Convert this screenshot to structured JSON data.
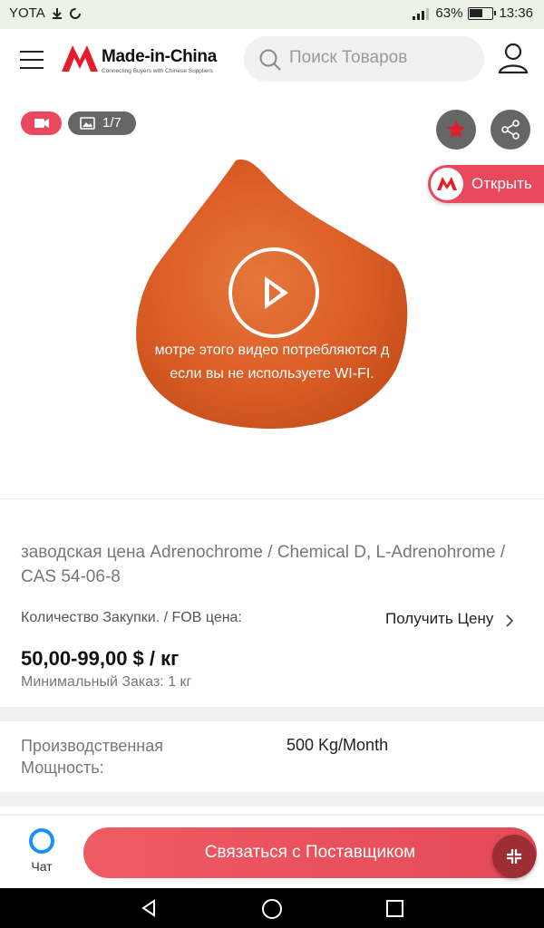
{
  "status_bar": {
    "carrier": "YOTA",
    "battery": "63%",
    "battery_fraction": 0.63,
    "time": "13:36"
  },
  "header": {
    "brand": "Made-in-China",
    "tagline": "Connecting Buyers with Chinese Suppliers",
    "search_placeholder": "Поиск Товаров"
  },
  "media": {
    "photo_counter": "1/7",
    "open_app_label": "Открыть",
    "video_notice_line1": "мотре этого видео потребляются д",
    "video_notice_line2": "если вы не используете WI-FI."
  },
  "product": {
    "title": "заводская цена Adrenochrome / Chemical D, L-Adrenohrome / CAS 54-06-8",
    "fob_label": "Количество Закупки. / FOB цена:",
    "get_price": "Получить Цену",
    "price": "50,00-99,00 $ / кг",
    "moq": "Минимальный Заказ: 1 кг"
  },
  "capacity": {
    "label": "Производственная Мощность:",
    "value": "500 Kg/Month"
  },
  "actions": {
    "chat_label": "Чат",
    "contact_label": "Связаться с Поставщиком"
  },
  "colors": {
    "accent": "#e8495c",
    "chat_blue": "#1890ff",
    "powder": "#e0662b"
  }
}
